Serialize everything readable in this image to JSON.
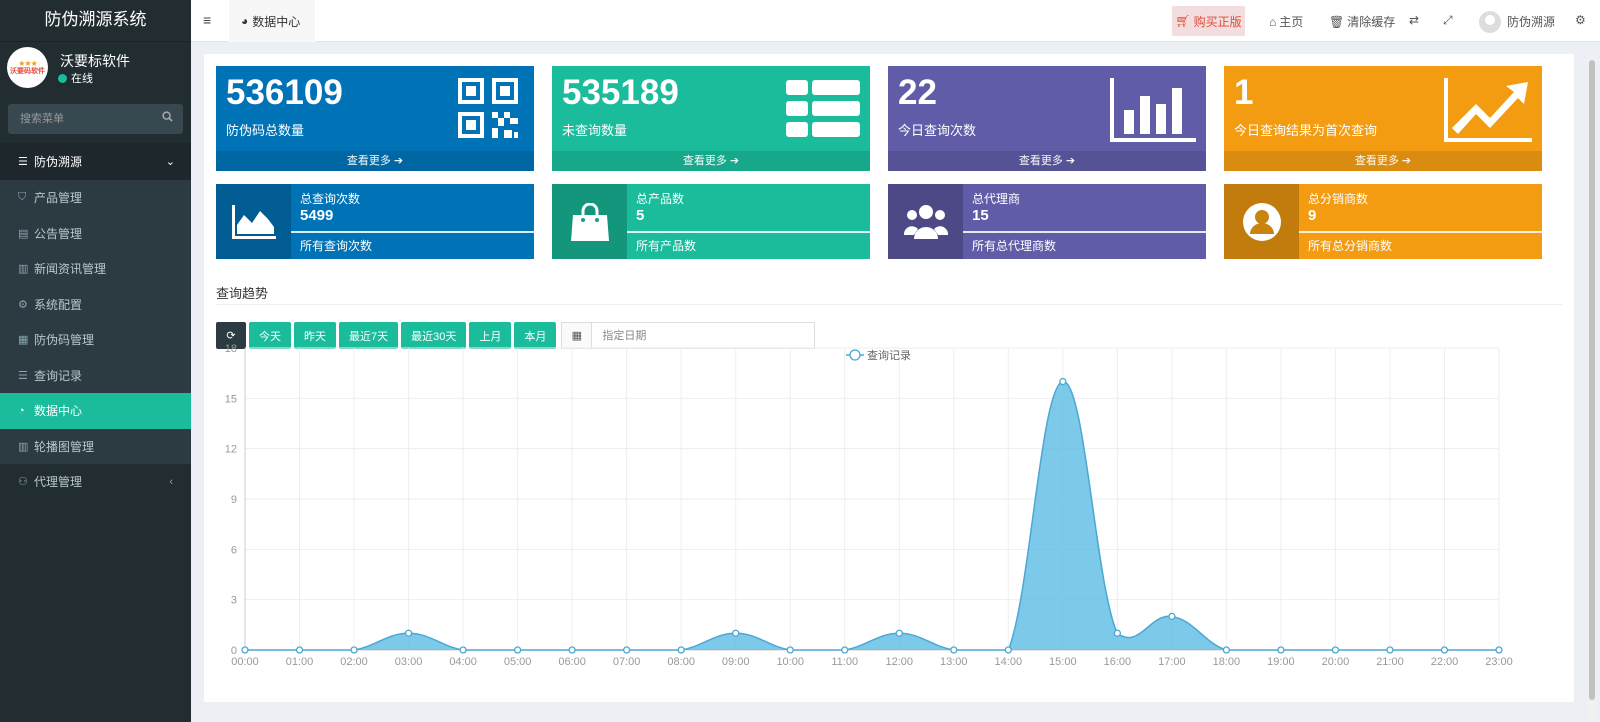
{
  "app": {
    "title": "防伪溯源系统"
  },
  "user": {
    "name": "沃要标软件",
    "status": "在线",
    "logo_text": "沃要码软件"
  },
  "search": {
    "placeholder": "搜索菜单"
  },
  "menu": {
    "group": "防伪溯源",
    "items": [
      {
        "label": "产品管理",
        "icon": "bag-icon"
      },
      {
        "label": "公告管理",
        "icon": "file-icon"
      },
      {
        "label": "新闻资讯管理",
        "icon": "newspaper-icon"
      },
      {
        "label": "系统配置",
        "icon": "gear-icon"
      },
      {
        "label": "防伪码管理",
        "icon": "barcode-icon"
      },
      {
        "label": "查询记录",
        "icon": "list-icon"
      },
      {
        "label": "数据中心",
        "icon": "dashboard-icon",
        "active": true
      },
      {
        "label": "轮播图管理",
        "icon": "image-icon"
      },
      {
        "label": "代理管理",
        "icon": "users-icon"
      }
    ]
  },
  "topbar": {
    "tab": "数据中心",
    "buy": "购买正版",
    "home": "主页",
    "clear_cache": "清除缓存",
    "username": "防伪溯源"
  },
  "stats": [
    {
      "value": "536109",
      "label": "防伪码总数量",
      "more": "查看更多",
      "color": "#0073b7",
      "icon": "qrcode-icon"
    },
    {
      "value": "535189",
      "label": "未查询数量",
      "more": "查看更多",
      "color": "#1abc9c",
      "icon": "th-list-icon"
    },
    {
      "value": "22",
      "label": "今日查询次数",
      "more": "查看更多",
      "color": "#605ca8",
      "icon": "bar-chart-icon"
    },
    {
      "value": "1",
      "label": "今日查询结果为首次查询",
      "more": "查看更多",
      "color": "#f39c12",
      "icon": "line-chart-icon"
    }
  ],
  "infos": [
    {
      "title": "总查询次数",
      "value": "5499",
      "desc": "所有查询次数",
      "icon": "area-chart-icon"
    },
    {
      "title": "总产品数",
      "value": "5",
      "desc": "所有产品数",
      "icon": "shopping-bag-icon"
    },
    {
      "title": "总代理商",
      "value": "15",
      "desc": "所有总代理商数",
      "icon": "users-icon"
    },
    {
      "title": "总分销商数",
      "value": "9",
      "desc": "所有总分销商数",
      "icon": "user-circle-icon"
    }
  ],
  "section": {
    "title": "查询趋势"
  },
  "filters": {
    "buttons": [
      "今天",
      "昨天",
      "最近7天",
      "最近30天",
      "上月",
      "本月"
    ],
    "date_placeholder": "指定日期"
  },
  "chart_data": {
    "type": "area",
    "legend": "查询记录",
    "legend_position": "top-center",
    "grid": true,
    "x": [
      "00:00",
      "01:00",
      "02:00",
      "03:00",
      "04:00",
      "05:00",
      "06:00",
      "07:00",
      "08:00",
      "09:00",
      "10:00",
      "11:00",
      "12:00",
      "13:00",
      "14:00",
      "15:00",
      "16:00",
      "17:00",
      "18:00",
      "19:00",
      "20:00",
      "21:00",
      "22:00",
      "23:00"
    ],
    "series": [
      {
        "name": "查询记录",
        "values": [
          0,
          0,
          0,
          1,
          0,
          0,
          0,
          0,
          0,
          1,
          0,
          0,
          1,
          0,
          0,
          16,
          1,
          2,
          0,
          0,
          0,
          0,
          0,
          0
        ]
      }
    ],
    "yticks": [
      0,
      3,
      6,
      9,
      12,
      15,
      18
    ],
    "ylim": [
      0,
      18
    ],
    "color": "#5bbce4"
  }
}
